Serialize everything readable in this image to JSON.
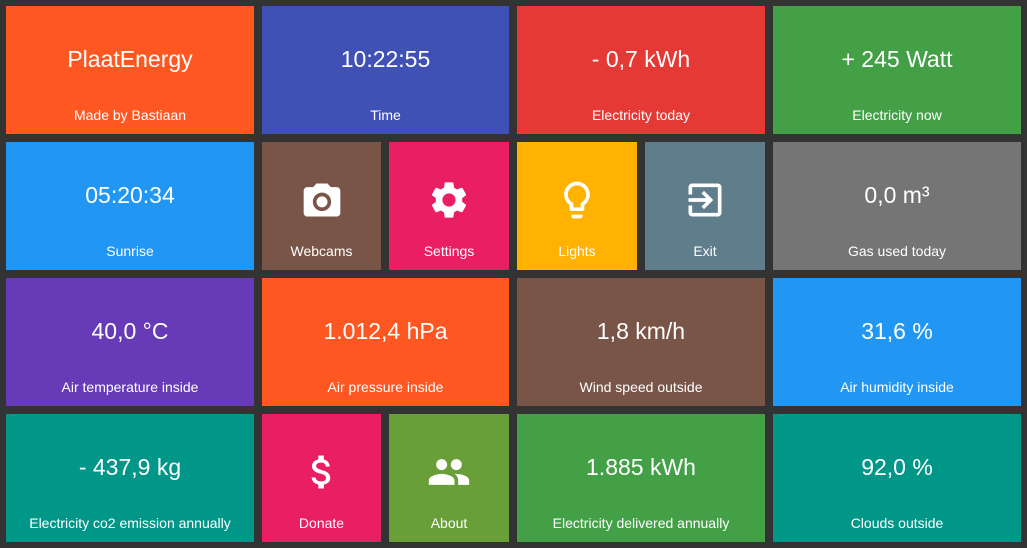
{
  "tiles": {
    "plaatenergy": {
      "value": "PlaatEnergy",
      "label": "Made by Bastiaan",
      "color": "#ff5722"
    },
    "time": {
      "value": "10:22:55",
      "label": "Time",
      "color": "#3f51b5"
    },
    "electricity_today": {
      "value": "- 0,7 kWh",
      "label": "Electricity today",
      "color": "#e53935"
    },
    "electricity_now": {
      "value": "+ 245 Watt",
      "label": "Electricity now",
      "color": "#43a047"
    },
    "sunrise": {
      "value": "05:20:34",
      "label": "Sunrise",
      "color": "#2196f3"
    },
    "webcams": {
      "label": "Webcams",
      "icon": "camera-icon",
      "color": "#795548"
    },
    "settings": {
      "label": "Settings",
      "icon": "gear-icon",
      "color": "#e91e63"
    },
    "lights": {
      "label": "Lights",
      "icon": "lightbulb-icon",
      "color": "#ffb300"
    },
    "exit": {
      "label": "Exit",
      "icon": "exit-icon",
      "color": "#607d8b"
    },
    "gas_today": {
      "value": "0,0 m³",
      "label": "Gas used today",
      "color": "#757575"
    },
    "air_temperature": {
      "value": "40,0 °C",
      "label": "Air temperature inside",
      "color": "#673ab7"
    },
    "air_pressure": {
      "value": "1.012,4 hPa",
      "label": "Air pressure inside",
      "color": "#ff5722"
    },
    "wind_speed": {
      "value": "1,8 km/h",
      "label": "Wind speed outside",
      "color": "#795548"
    },
    "air_humidity": {
      "value": "31,6 %",
      "label": "Air humidity inside",
      "color": "#2196f3"
    },
    "co2_emission": {
      "value": "- 437,9 kg",
      "label": "Electricity co2 emission annually",
      "color": "#009688"
    },
    "donate": {
      "label": "Donate",
      "icon": "dollar-icon",
      "color": "#e91e63"
    },
    "about": {
      "label": "About",
      "icon": "people-icon",
      "color": "#689f38"
    },
    "electricity_annual": {
      "value": "1.885 kWh",
      "label": "Electricity delivered annually",
      "color": "#43a047"
    },
    "clouds": {
      "value": "92,0 %",
      "label": "Clouds outside",
      "color": "#009688"
    }
  }
}
